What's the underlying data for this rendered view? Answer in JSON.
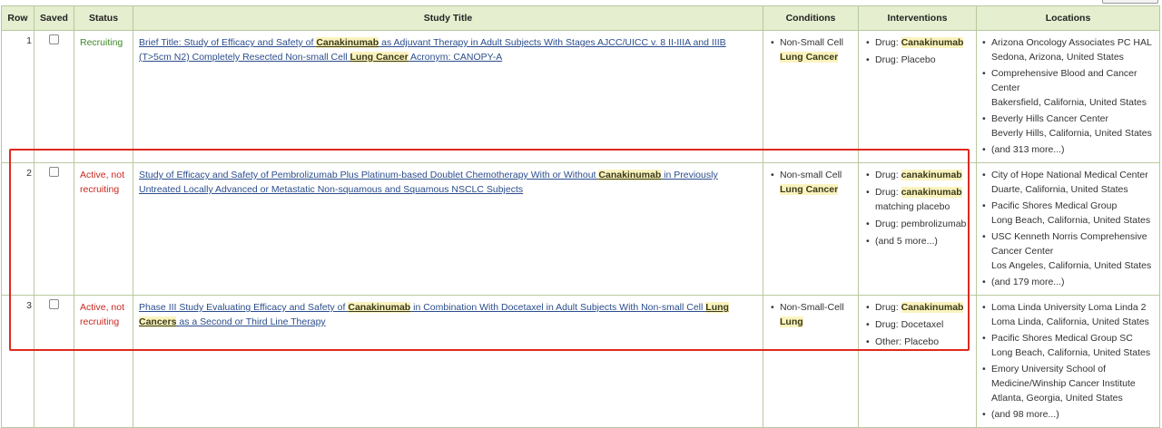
{
  "headers": {
    "row": "Row",
    "saved": "Saved",
    "status": "Status",
    "study_title": "Study Title",
    "conditions": "Conditions",
    "interventions": "Interventions",
    "locations": "Locations"
  },
  "rows": [
    {
      "row": "1",
      "status": "Recruiting",
      "title": {
        "t1": "Brief Title: Study of Efficacy and Safety of ",
        "h1": "Canakinumab",
        "t2": " as Adjuvant Therapy in Adult Subjects With Stages AJCC/UICC v. 8 II-IIIA and IIIB (T>5cm N2) Completely Resected Non-small Cell ",
        "h2": "Lung Cancer",
        "t3": " Acronym: CANOPY-A"
      },
      "condition": {
        "pre": "Non-Small Cell",
        "hl": "Lung Cancer"
      },
      "interventions": [
        {
          "pre": "Drug: ",
          "hl": "Canakinumab",
          "post": ""
        },
        {
          "pre": "Drug: Placebo",
          "hl": "",
          "post": ""
        }
      ],
      "locations": [
        {
          "name": "Arizona Oncology Associates PC HAL",
          "place": "Sedona, Arizona, United States"
        },
        {
          "name": "Comprehensive Blood and Cancer Center",
          "place": "Bakersfield, California, United States"
        },
        {
          "name": "Beverly Hills Cancer Center",
          "place": "Beverly Hills, California, United States"
        }
      ],
      "more_locations": "(and 313 more...)"
    },
    {
      "row": "2",
      "status": "Active, not recruiting",
      "title": {
        "t1": "Study of Efficacy and Safety of Pembrolizumab Plus Platinum-based Doublet Chemotherapy With or Without ",
        "h1": "Canakinumab",
        "t2": " in Previously Untreated Locally Advanced or Metastatic Non-squamous and Squamous NSCLC Subjects",
        "h2": "",
        "t3": ""
      },
      "condition": {
        "pre": "Non-small Cell",
        "hl": "Lung Cancer"
      },
      "interventions": [
        {
          "pre": "Drug: ",
          "hl": "canakinumab",
          "post": ""
        },
        {
          "pre": "Drug: ",
          "hl": "canakinumab",
          "post": " matching placebo"
        },
        {
          "pre": "Drug: pembrolizumab",
          "hl": "",
          "post": ""
        },
        {
          "pre": "(and 5 more...)",
          "hl": "",
          "post": ""
        }
      ],
      "locations": [
        {
          "name": "City of Hope National Medical Center",
          "place": "Duarte, California, United States"
        },
        {
          "name": "Pacific Shores Medical Group",
          "place": "Long Beach, California, United States"
        },
        {
          "name": "USC Kenneth Norris Comprehensive Cancer Center",
          "place": "Los Angeles, California, United States"
        }
      ],
      "more_locations": "(and 179 more...)"
    },
    {
      "row": "3",
      "status": "Active, not recruiting",
      "title": {
        "t1": "Phase III Study Evaluating Efficacy and Safety of ",
        "h1": "Canakinumab",
        "t2": " in Combination With Docetaxel in Adult Subjects With Non-small Cell ",
        "h2": "Lung Cancers",
        "t3": " as a Second or Third Line Therapy"
      },
      "condition": {
        "pre": "Non-Small-Cell",
        "hl": "Lung"
      },
      "interventions": [
        {
          "pre": "Drug: ",
          "hl": "Canakinumab",
          "post": ""
        },
        {
          "pre": "Drug: Docetaxel",
          "hl": "",
          "post": ""
        },
        {
          "pre": "Other: Placebo",
          "hl": "",
          "post": ""
        }
      ],
      "locations": [
        {
          "name": "Loma Linda University Loma Linda 2",
          "place": "Loma Linda, California, United States"
        },
        {
          "name": "Pacific Shores Medical Group SC",
          "place": "Long Beach, California, United States"
        },
        {
          "name": "Emory University School of Medicine/Winship Cancer Institute",
          "place": "Atlanta, Georgia, United States"
        }
      ],
      "more_locations": "(and 98 more...)"
    }
  ],
  "colors": {
    "header_bg": "#e5eecf",
    "recruiting": "#3c8a2a",
    "not_recruiting": "#c8281f",
    "link": "#2b4d8c",
    "highlight": "#fbf3bf",
    "selection": "#e0281f"
  }
}
